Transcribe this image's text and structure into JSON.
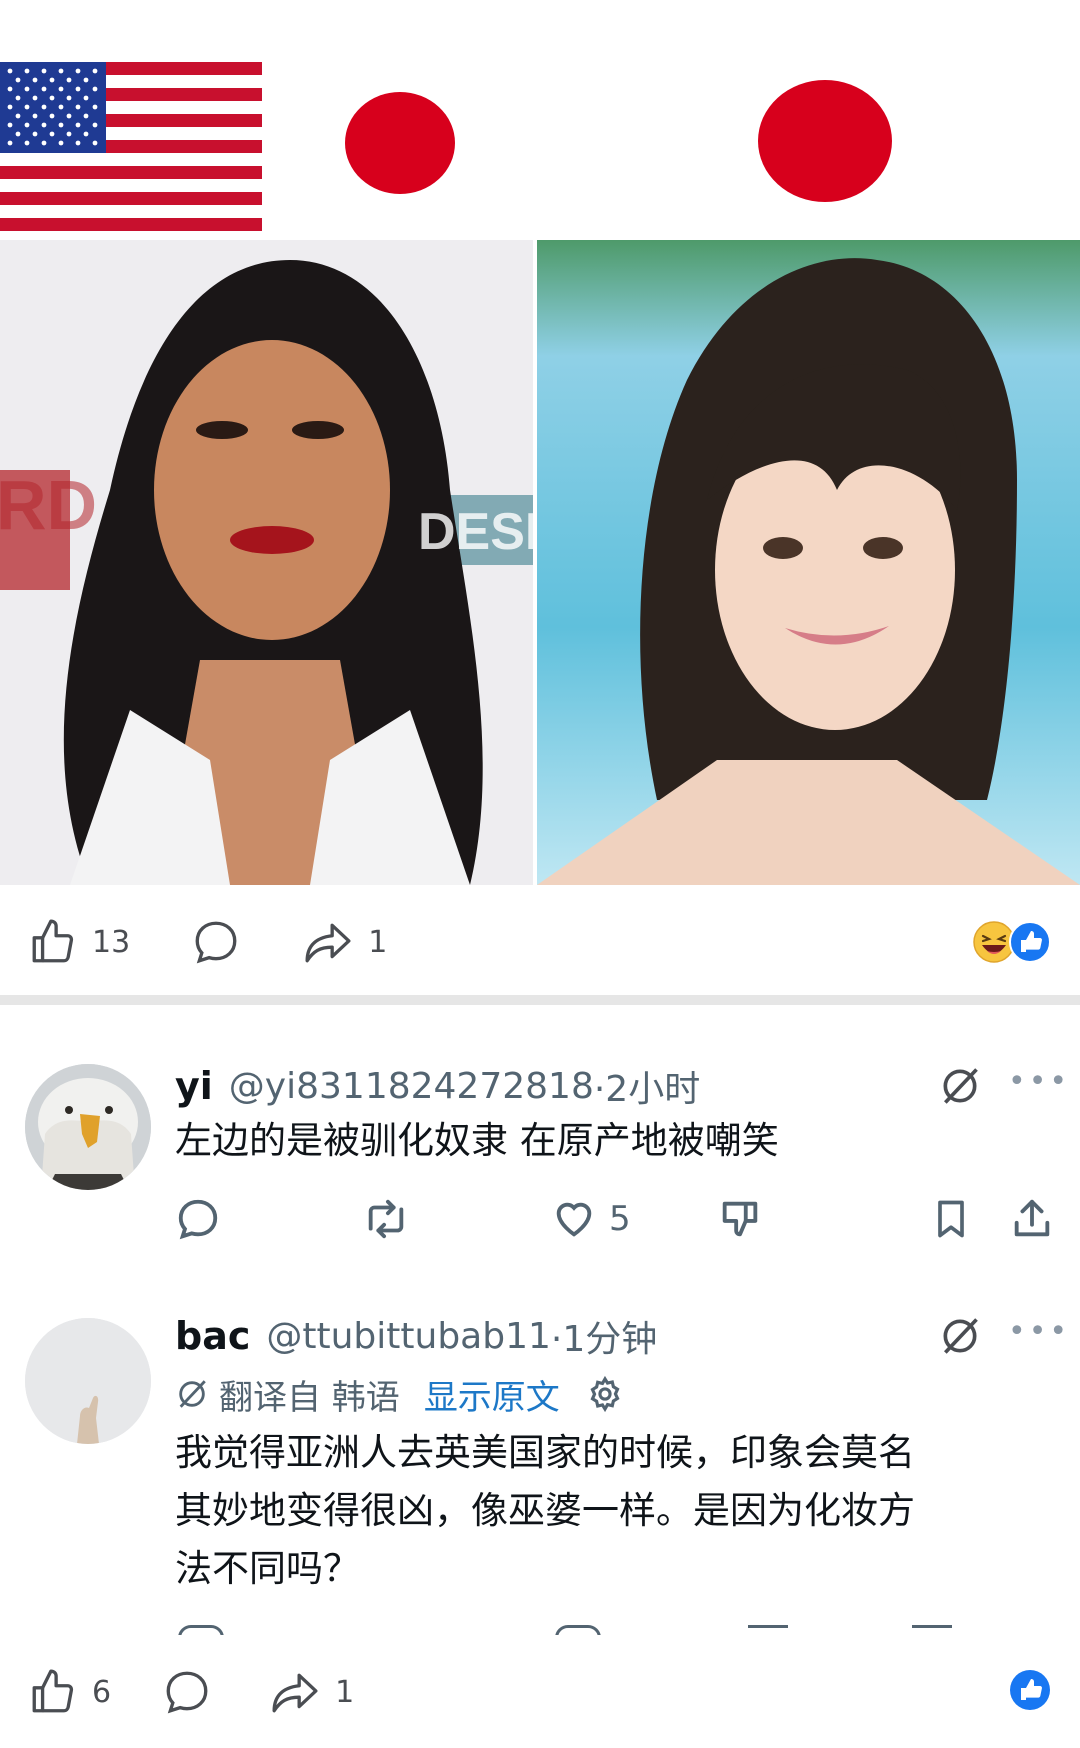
{
  "post": {
    "like_count": "13",
    "share_count": "1",
    "image_text_left": "RD",
    "image_text_right": "DESI"
  },
  "comments": [
    {
      "name": "yi",
      "handle": "@yi8311824272818",
      "time": "·2小时",
      "text": "左边的是被驯化奴隶 在原产地被嘲笑",
      "likes": "5"
    },
    {
      "name": "bac",
      "handle": "@ttubittubab11",
      "time": "·1分钟",
      "translated_from": "翻译自 韩语",
      "show_original": "显示原文",
      "text_lines": [
        "我觉得亚洲人去英美国家的时候，印象会莫名",
        "其妙地变得很凶，像巫婆一样。是因为化妆方",
        "法不同吗？"
      ]
    }
  ],
  "footer": {
    "like_count": "6",
    "share_count": "1"
  },
  "colors": {
    "flag_red": "#d7001c",
    "flag_blue": "#1f3a93",
    "like_blue": "#1877f2",
    "divider": "#e6e6e6"
  }
}
